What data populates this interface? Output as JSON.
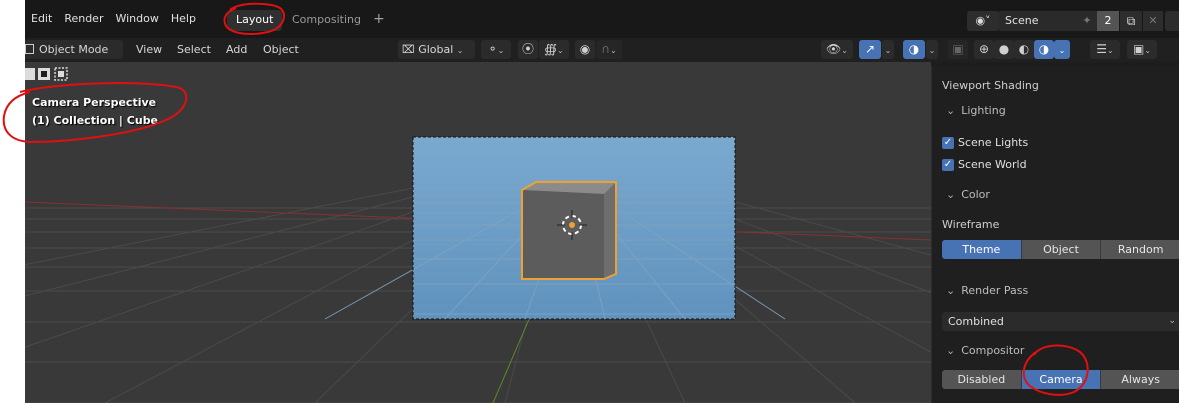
{
  "menu": {
    "items": [
      "Edit",
      "Render",
      "Window",
      "Help"
    ]
  },
  "workspaces": {
    "active": "Layout",
    "inactive": "Compositing",
    "add_icon": "+"
  },
  "scene": {
    "name": "Scene",
    "users": "2"
  },
  "header": {
    "mode": "Object Mode",
    "view": "View",
    "select": "Select",
    "add": "Add",
    "object": "Object",
    "orientation": "Global"
  },
  "overlay": {
    "view_name": "Camera Perspective",
    "collection": "(1) Collection | Cube"
  },
  "shading": {
    "title": "Viewport Shading",
    "lighting": "Lighting",
    "scene_lights": "Scene Lights",
    "scene_world": "Scene World",
    "color": "Color",
    "wireframe": "Wireframe",
    "wire_options": [
      "Theme",
      "Object",
      "Random"
    ],
    "wire_selected": "Theme",
    "render_pass": "Render Pass",
    "render_pass_value": "Combined",
    "compositor": "Compositor",
    "comp_options": [
      "Disabled",
      "Camera",
      "Always"
    ],
    "comp_selected": "Camera"
  },
  "colors": {
    "accent": "#4772b3",
    "annotation": "#e01010",
    "selection": "#f0a030"
  }
}
